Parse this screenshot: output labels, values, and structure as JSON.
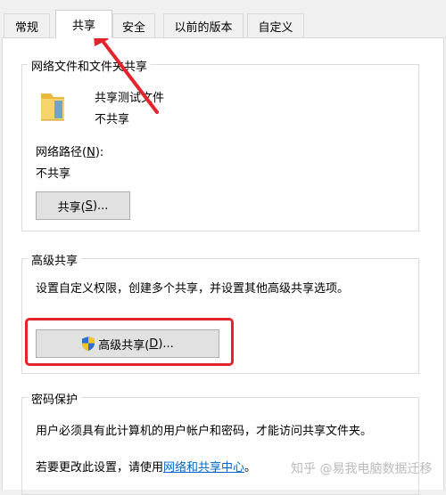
{
  "tabs": [
    {
      "label": "常规",
      "active": false
    },
    {
      "label": "共享",
      "active": true
    },
    {
      "label": "安全",
      "active": false
    },
    {
      "label": "以前的版本",
      "active": false
    },
    {
      "label": "自定义",
      "active": false
    }
  ],
  "network_sharing": {
    "title": "网络文件和文件夹共享",
    "folder_name": "共享测试文件",
    "folder_status": "不共享",
    "path_label_prefix": "网络路径(",
    "path_label_key": "N",
    "path_label_suffix": "):",
    "path_value": "不共享",
    "share_button_prefix": "共享(",
    "share_button_key": "S",
    "share_button_suffix": ")..."
  },
  "advanced_sharing": {
    "title": "高级共享",
    "description": "设置自定义权限，创建多个共享，并设置其他高级共享选项。",
    "button_prefix": "高级共享(",
    "button_key": "D",
    "button_suffix": ")..."
  },
  "password_protection": {
    "title": "密码保护",
    "description": "用户必须具有此计算机的用户帐户和密码，才能访问共享文件夹。",
    "change_prefix": "若要更改此设置，请使用",
    "change_link": "网络和共享中心",
    "change_suffix": "。"
  },
  "watermark": "知乎 @易我电脑数据迁移",
  "colors": {
    "annotation_red": "#e3242b",
    "link_blue": "#0066cc",
    "folder_yellow": "#f2c94c"
  },
  "icons": {
    "folder": "folder-icon",
    "shield": "uac-shield-icon"
  }
}
